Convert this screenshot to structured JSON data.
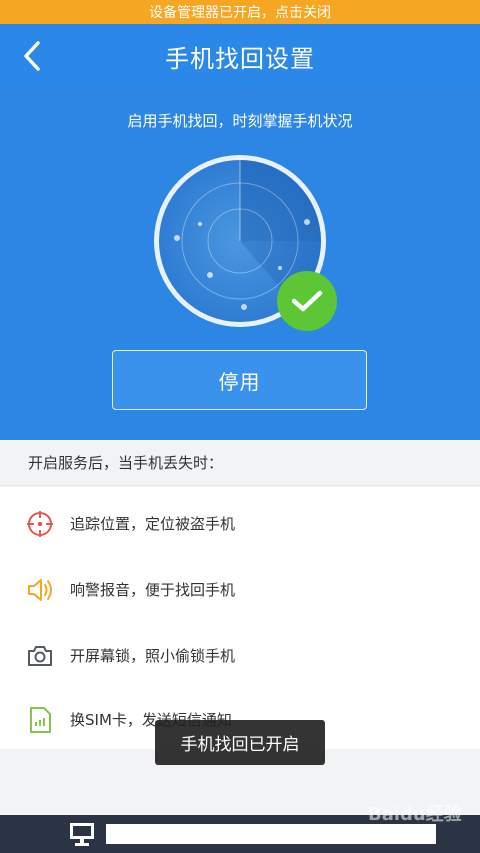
{
  "notice": {
    "text": "设备管理器已开启，点击关闭"
  },
  "header": {
    "title": "手机找回设置",
    "back_icon": "chevron-left-icon"
  },
  "hero": {
    "subtitle": "启用手机找回，时刻掌握手机状况",
    "status_icon": "checkmark-icon",
    "disable_button_label": "停用"
  },
  "section": {
    "title": "开启服务后，当手机丢失时："
  },
  "features": [
    {
      "icon": "crosshair-icon",
      "label": "追踪位置，定位被盗手机",
      "color": "#e8564f"
    },
    {
      "icon": "speaker-icon",
      "label": "响警报音，便于找回手机",
      "color": "#f5a623"
    },
    {
      "icon": "camera-icon",
      "label": "开屏幕锁，照小偷锁手机",
      "color": "#555a63"
    },
    {
      "icon": "sim-card-icon",
      "label": "换SIM卡，发送短信通知",
      "color": "#8bc34a"
    }
  ],
  "toast": {
    "text": "手机找回已开启"
  },
  "watermark": {
    "text": "Baidu经验"
  },
  "colors": {
    "notice": "#f5a623",
    "primary": "#2b87e8",
    "success": "#5cc636"
  }
}
